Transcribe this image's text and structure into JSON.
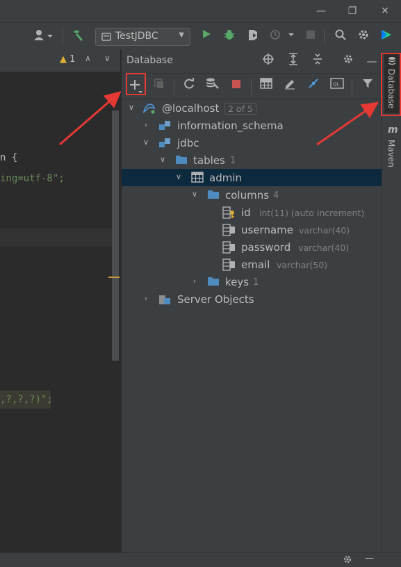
{
  "toolbar": {
    "run_config": "TestJDBC"
  },
  "editor": {
    "warning_count": "1",
    "lines": [
      {
        "text": "n {",
        "color": "#a9b7c6"
      },
      {
        "text": "ing=utf-8\";",
        "color": "#6a8759"
      },
      {
        "text": ",?,?,?)\";",
        "color": "#6a8759"
      }
    ]
  },
  "database_panel": {
    "title": "Database",
    "tree": {
      "host": {
        "label": "@localhost",
        "badge": "2 of 5"
      },
      "information_schema": {
        "label": "information_schema"
      },
      "jdbc": {
        "label": "jdbc"
      },
      "tables": {
        "label": "tables",
        "count": "1"
      },
      "admin": {
        "label": "admin"
      },
      "columns": {
        "label": "columns",
        "count": "4"
      },
      "cols": [
        {
          "name": "id",
          "type": "int(11) (auto increment)"
        },
        {
          "name": "username",
          "type": "varchar(40)"
        },
        {
          "name": "password",
          "type": "varchar(40)"
        },
        {
          "name": "email",
          "type": "varchar(50)"
        }
      ],
      "keys": {
        "label": "keys",
        "count": "1"
      },
      "server_objects": {
        "label": "Server Objects"
      }
    }
  },
  "right_strip": {
    "database_tab": "Database",
    "maven_tab": "Maven"
  },
  "colors": {
    "accent_red": "#e53935",
    "selection": "#0d293e",
    "run_green": "#59a869",
    "folder_blue": "#4e8bbf"
  }
}
